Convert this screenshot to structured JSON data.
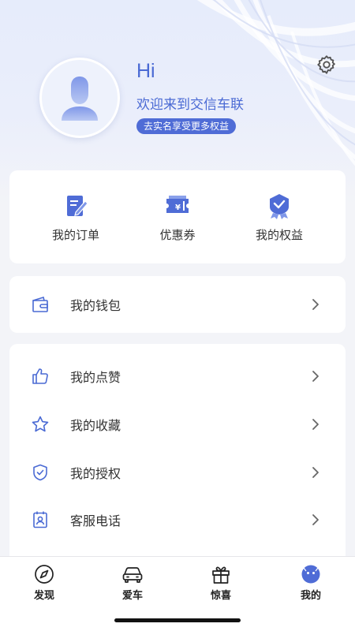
{
  "colors": {
    "accent": "#4f6cd6",
    "text": "#333333",
    "chevron": "#666666",
    "icon": "#4a6ad4"
  },
  "profile": {
    "greeting": "Hi",
    "welcome": "欢迎来到交信车联",
    "verify_badge": "去实名享受更多权益",
    "avatar_icon": "user-silhouette-icon",
    "settings_icon": "gear-icon"
  },
  "quick_actions": [
    {
      "label": "我的订单",
      "icon": "order-edit-icon"
    },
    {
      "label": "优惠券",
      "icon": "coupon-icon"
    },
    {
      "label": "我的权益",
      "icon": "rights-medal-icon"
    }
  ],
  "wallet": {
    "label": "我的钱包",
    "icon": "wallet-icon"
  },
  "menu": [
    {
      "label": "我的点赞",
      "icon": "thumb-up-icon"
    },
    {
      "label": "我的收藏",
      "icon": "star-icon"
    },
    {
      "label": "我的授权",
      "icon": "shield-check-icon"
    },
    {
      "label": "客服电话",
      "icon": "contact-card-icon"
    }
  ],
  "tabs": [
    {
      "label": "发现",
      "icon": "compass-icon",
      "active": false
    },
    {
      "label": "爱车",
      "icon": "car-icon",
      "active": false
    },
    {
      "label": "惊喜",
      "icon": "gift-icon",
      "active": false
    },
    {
      "label": "我的",
      "icon": "profile-face-icon",
      "active": true
    }
  ]
}
